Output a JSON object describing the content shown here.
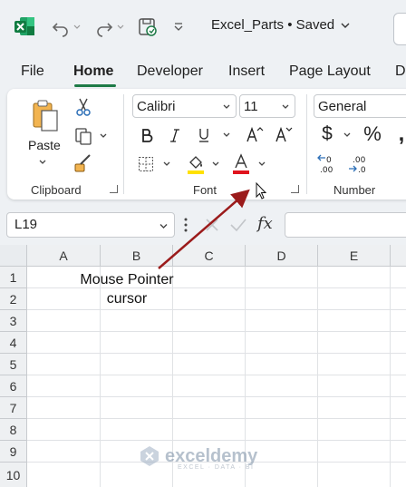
{
  "titlebar": {
    "document_title": "Excel_Parts • Saved",
    "icons": [
      "excel-logo-icon",
      "undo-icon",
      "redo-icon",
      "autosave-icon",
      "customize-qat-icon"
    ]
  },
  "tabs": [
    {
      "label": "File",
      "active": false
    },
    {
      "label": "Home",
      "active": true
    },
    {
      "label": "Developer",
      "active": false
    },
    {
      "label": "Insert",
      "active": false
    },
    {
      "label": "Page Layout",
      "active": false
    },
    {
      "label": "D",
      "active": false
    }
  ],
  "ribbon": {
    "clipboard": {
      "label": "Clipboard",
      "paste_label": "Paste"
    },
    "font": {
      "label": "Font",
      "font_name": "Calibri",
      "font_size": "11"
    },
    "number": {
      "label": "Number",
      "format": "General"
    }
  },
  "formula_bar": {
    "name_box": "L19",
    "fx_label": "fx",
    "formula": ""
  },
  "sheet": {
    "columns": [
      "A",
      "B",
      "C",
      "D",
      "E"
    ],
    "rows": [
      "1",
      "2",
      "3",
      "4",
      "5",
      "6",
      "7",
      "8",
      "9",
      "10"
    ]
  },
  "annotation": {
    "line1": "Mouse Pointer",
    "line2": "cursor",
    "arrow_color": "#9b1b1b"
  },
  "watermark": {
    "name": "exceldemy",
    "tagline": "EXCEL · DATA · BI"
  },
  "colors": {
    "accent": "#1e7a47",
    "highlight_yellow": "#ffe100",
    "font_red": "#e0141e"
  }
}
